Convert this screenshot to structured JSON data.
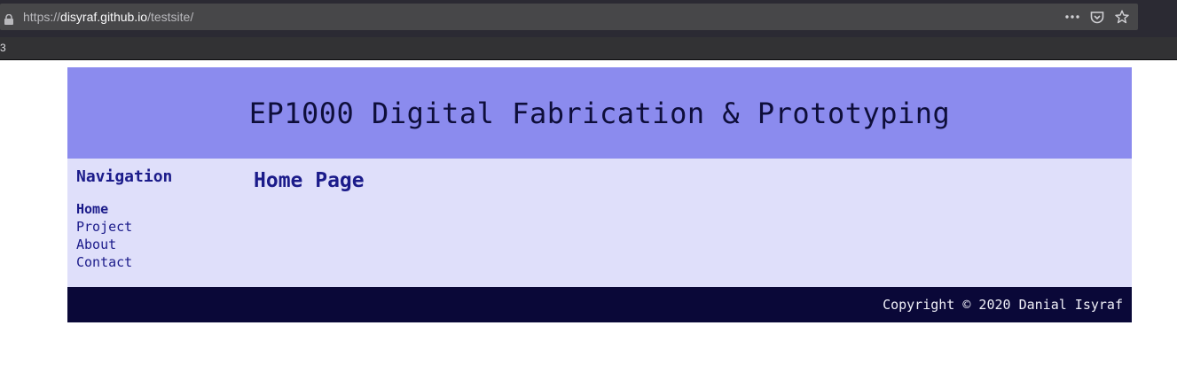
{
  "browser": {
    "url_prefix": "https://",
    "url_host": "disyraf.github.io",
    "url_path": "/testsite/",
    "actions": [
      "more-icon",
      "pocket-icon",
      "bookmark-star-icon"
    ],
    "bookmarks_edge_text": "3"
  },
  "header": {
    "title": "EP1000 Digital Fabrication & Prototyping"
  },
  "nav": {
    "heading": "Navigation",
    "items": [
      {
        "label": "Home",
        "active": true
      },
      {
        "label": "Project",
        "active": false
      },
      {
        "label": "About",
        "active": false
      },
      {
        "label": "Contact",
        "active": false
      }
    ]
  },
  "main": {
    "title": "Home Page"
  },
  "footer": {
    "copyright": "Copyright © 2020 Danial Isyraf"
  },
  "colors": {
    "header_bg": "#8b8bee",
    "body_bg": "#dfdffa",
    "footer_bg": "#0a0838",
    "link": "#1b1b8a"
  }
}
